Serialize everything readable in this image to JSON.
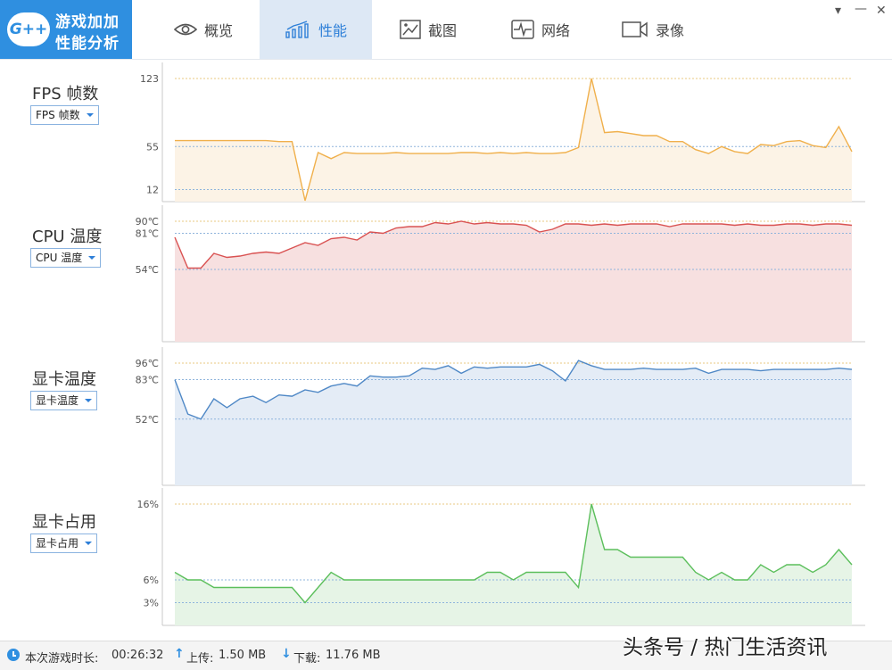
{
  "app": {
    "logo_badge": "G++",
    "logo_line1": "游戏加加",
    "logo_line2": "性能分析"
  },
  "tabs": [
    {
      "label": "概览",
      "icon": "eye-icon"
    },
    {
      "label": "性能",
      "icon": "bar-chart-icon",
      "active": true
    },
    {
      "label": "截图",
      "icon": "image-icon"
    },
    {
      "label": "网络",
      "icon": "pulse-icon"
    },
    {
      "label": "录像",
      "icon": "video-camera-icon"
    }
  ],
  "window": {
    "menu_glyph": "▾",
    "minimize_glyph": "—",
    "close_glyph": "✕"
  },
  "metrics": [
    {
      "title": "FPS 帧数",
      "selector": "FPS 帧数"
    },
    {
      "title": "CPU 温度",
      "selector": "CPU 温度"
    },
    {
      "title": "显卡温度",
      "selector": "显卡温度"
    },
    {
      "title": "显卡占用",
      "selector": "显卡占用"
    }
  ],
  "chart_data": [
    {
      "type": "area",
      "ylabel": "FPS 帧数",
      "ylim": [
        0,
        123
      ],
      "y_ticks": [
        {
          "value": 123,
          "label": "123"
        },
        {
          "value": 55,
          "label": "55"
        },
        {
          "value": 12,
          "label": "12"
        }
      ],
      "color": "#f0b04c",
      "fill": "#fcf3e6",
      "values": [
        61,
        61,
        61,
        61,
        61,
        61,
        61,
        61,
        60,
        60,
        1,
        49,
        43,
        49,
        48,
        48,
        48,
        49,
        48,
        48,
        48,
        48,
        49,
        49,
        48,
        49,
        48,
        49,
        48,
        48,
        49,
        54,
        123,
        69,
        70,
        68,
        66,
        66,
        60,
        60,
        52,
        48,
        55,
        50,
        48,
        57,
        56,
        60,
        61,
        56,
        54,
        75,
        50
      ]
    },
    {
      "type": "area",
      "ylabel": "CPU 温度",
      "ylim": [
        0,
        90
      ],
      "y_ticks": [
        {
          "value": 90,
          "label": "90℃"
        },
        {
          "value": 81,
          "label": "81℃"
        },
        {
          "value": 54,
          "label": "54℃"
        }
      ],
      "color": "#d95252",
      "fill": "#f7e0e0",
      "values": [
        78,
        55,
        55,
        66,
        63,
        64,
        66,
        67,
        66,
        70,
        74,
        72,
        77,
        78,
        76,
        82,
        81,
        85,
        86,
        86,
        89,
        88,
        90,
        88,
        89,
        88,
        88,
        87,
        82,
        84,
        88,
        88,
        87,
        88,
        87,
        88,
        88,
        88,
        86,
        88,
        88,
        88,
        88,
        87,
        88,
        87,
        87,
        88,
        88,
        87,
        88,
        88,
        87
      ]
    },
    {
      "type": "area",
      "ylabel": "显卡温度",
      "ylim": [
        0,
        96
      ],
      "y_ticks": [
        {
          "value": 96,
          "label": "96℃"
        },
        {
          "value": 83,
          "label": "83℃"
        },
        {
          "value": 52,
          "label": "52℃"
        }
      ],
      "color": "#4f88c6",
      "fill": "#e4ecf6",
      "values": [
        83,
        56,
        52,
        68,
        61,
        68,
        70,
        65,
        71,
        70,
        75,
        73,
        78,
        80,
        78,
        86,
        85,
        85,
        86,
        92,
        91,
        94,
        88,
        93,
        92,
        93,
        93,
        93,
        95,
        90,
        82,
        98,
        94,
        91,
        91,
        91,
        92,
        91,
        91,
        91,
        92,
        88,
        91,
        91,
        91,
        90,
        91,
        91,
        91,
        91,
        91,
        92,
        91
      ]
    },
    {
      "type": "area",
      "ylabel": "显卡占用",
      "ylim": [
        0,
        16
      ],
      "y_ticks": [
        {
          "value": 16,
          "label": "16%"
        },
        {
          "value": 6,
          "label": "6%"
        },
        {
          "value": 3,
          "label": "3%"
        }
      ],
      "color": "#5cbf5c",
      "fill": "#e6f4e6",
      "values": [
        7,
        6,
        6,
        5,
        5,
        5,
        5,
        5,
        5,
        5,
        3,
        5,
        7,
        6,
        6,
        6,
        6,
        6,
        6,
        6,
        6,
        6,
        6,
        6,
        7,
        7,
        6,
        7,
        7,
        7,
        7,
        5,
        16,
        10,
        10,
        9,
        9,
        9,
        9,
        9,
        7,
        6,
        7,
        6,
        6,
        8,
        7,
        8,
        8,
        7,
        8,
        10,
        8
      ]
    }
  ],
  "status": {
    "duration_label": "本次游戏时长:",
    "duration_value": "00:26:32",
    "upload_label": "上传:",
    "upload_value": "1.50 MB",
    "download_label": "下载:",
    "download_value": "11.76 MB",
    "upload_glyph": "↑",
    "download_glyph": "↓"
  },
  "watermark": "头条号 / 热门生活资讯"
}
